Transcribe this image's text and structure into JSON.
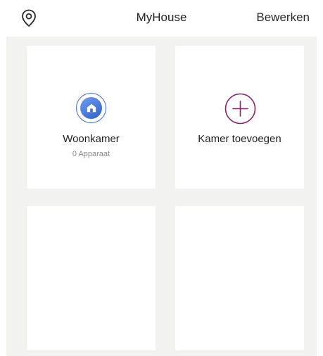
{
  "header": {
    "title": "MyHouse",
    "edit_label": "Bewerken",
    "location_icon": "location-pin-icon"
  },
  "rooms": [
    {
      "name": "Woonkamer",
      "subtitle": "0 Apparaat",
      "icon": "home-icon"
    }
  ],
  "add_room": {
    "label": "Kamer toevoegen",
    "icon": "plus-circle-icon"
  },
  "colors": {
    "home_icon": "#3d6fd6",
    "add_icon": "#8e1f6b",
    "grid_background": "#f2f2f1"
  }
}
